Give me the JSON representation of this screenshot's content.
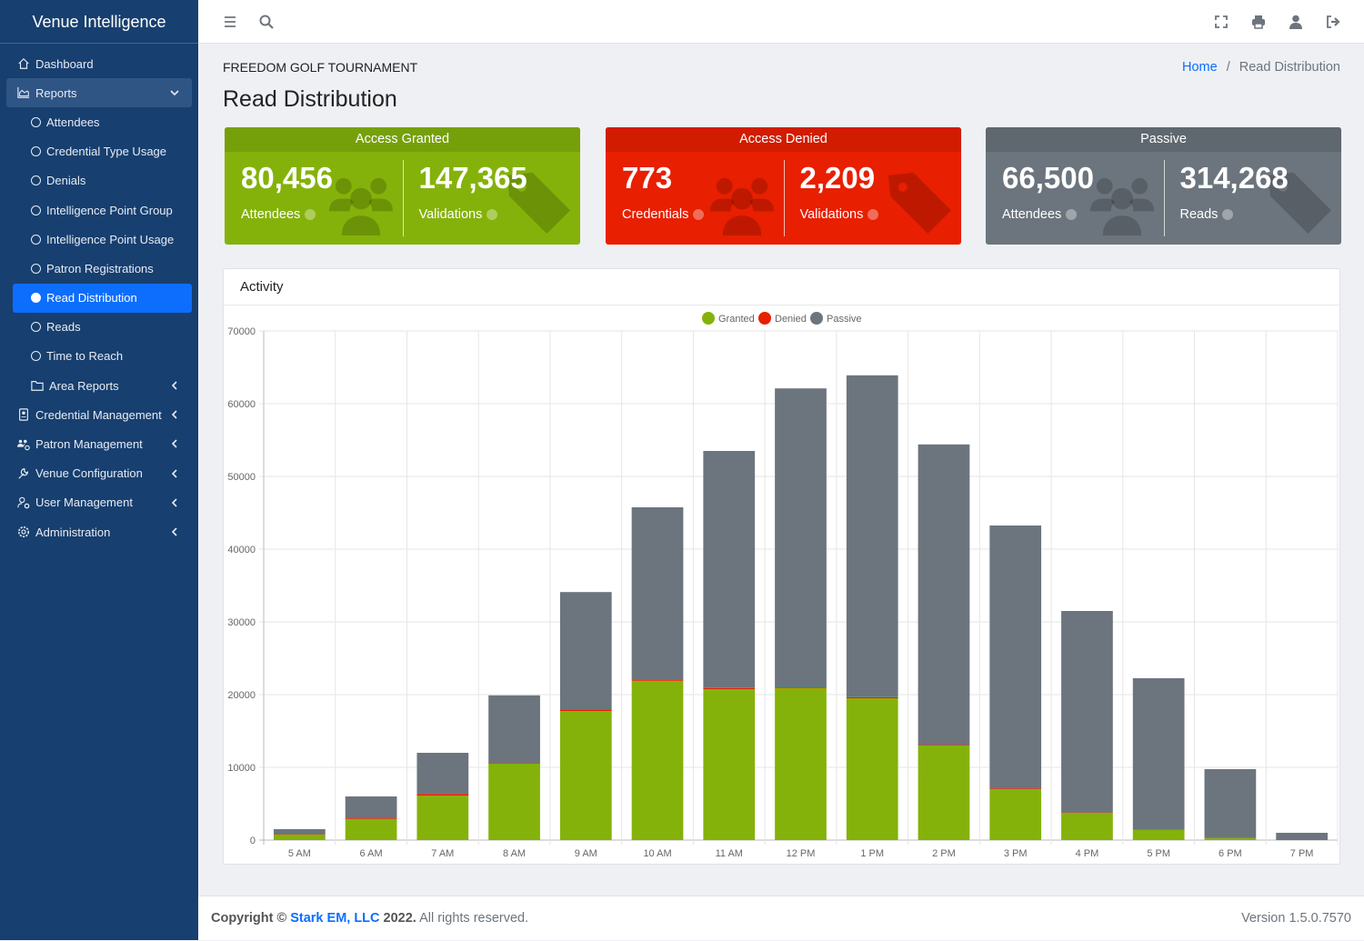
{
  "app": {
    "title": "Venue Intelligence"
  },
  "sidebar": {
    "items": [
      {
        "label": "Dashboard",
        "icon": "home-icon"
      },
      {
        "label": "Reports",
        "icon": "chart-area-icon",
        "expanded": true
      },
      {
        "label": "Attendees",
        "sub": true
      },
      {
        "label": "Credential Type Usage",
        "sub": true
      },
      {
        "label": "Denials",
        "sub": true
      },
      {
        "label": "Intelligence Point Group",
        "sub": true
      },
      {
        "label": "Intelligence Point Usage",
        "sub": true
      },
      {
        "label": "Patron Registrations",
        "sub": true
      },
      {
        "label": "Read Distribution",
        "sub": true,
        "active": true
      },
      {
        "label": "Reads",
        "sub": true
      },
      {
        "label": "Time to Reach",
        "sub": true
      },
      {
        "label": "Area Reports",
        "sub": true,
        "icon": "folder-icon",
        "chevron": true
      },
      {
        "label": "Credential Management",
        "icon": "id-badge-icon",
        "chevron": true
      },
      {
        "label": "Patron Management",
        "icon": "users-cog-icon",
        "chevron": true
      },
      {
        "label": "Venue Configuration",
        "icon": "wrench-icon",
        "chevron": true
      },
      {
        "label": "User Management",
        "icon": "user-cog-icon",
        "chevron": true
      },
      {
        "label": "Administration",
        "icon": "gear-icon",
        "chevron": true
      }
    ]
  },
  "topbar": {
    "icons": [
      "menu-icon",
      "search-icon",
      "fullscreen-icon",
      "print-icon",
      "user-icon",
      "logout-icon"
    ]
  },
  "header": {
    "event": "FREEDOM GOLF TOURNAMENT",
    "title": "Read Distribution",
    "breadcrumb": {
      "home": "Home",
      "sep": "/",
      "current": "Read Distribution"
    }
  },
  "cards": [
    {
      "title": "Access Granted",
      "color": "#84b20a",
      "header_color": "#76a00a",
      "left": {
        "value": "80,456",
        "label": "Attendees"
      },
      "right": {
        "value": "147,365",
        "label": "Validations"
      }
    },
    {
      "title": "Access Denied",
      "color": "#e81f00",
      "header_color": "#d11c00",
      "left": {
        "value": "773",
        "label": "Credentials"
      },
      "right": {
        "value": "2,209",
        "label": "Validations"
      }
    },
    {
      "title": "Passive",
      "color": "#6c757d",
      "header_color": "#5f676f",
      "left": {
        "value": "66,500",
        "label": "Attendees"
      },
      "right": {
        "value": "314,268",
        "label": "Reads"
      }
    }
  ],
  "activity": {
    "title": "Activity"
  },
  "chart_data": {
    "type": "bar",
    "stacked": true,
    "title": "",
    "xlabel": "",
    "ylabel": "",
    "categories": [
      "5 AM",
      "6 AM",
      "7 AM",
      "8 AM",
      "9 AM",
      "10 AM",
      "11 AM",
      "12 PM",
      "1 PM",
      "2 PM",
      "3 PM",
      "4 PM",
      "5 PM",
      "6 PM",
      "7 PM"
    ],
    "ylim": [
      0,
      70000
    ],
    "yticks": [
      0,
      10000,
      20000,
      30000,
      40000,
      50000,
      60000,
      70000
    ],
    "grid": true,
    "legend": "top",
    "series": [
      {
        "name": "Granted",
        "color": "#84b20a",
        "values": [
          750,
          2900,
          6100,
          10500,
          17750,
          21900,
          20750,
          20900,
          19500,
          13000,
          7000,
          3750,
          1400,
          250,
          0
        ]
      },
      {
        "name": "Denied",
        "color": "#e81f00",
        "values": [
          50,
          100,
          250,
          100,
          200,
          150,
          150,
          100,
          150,
          100,
          100,
          50,
          30,
          20,
          0
        ]
      },
      {
        "name": "Passive",
        "color": "#6c757d",
        "values": [
          700,
          3000,
          5650,
          9300,
          16150,
          23700,
          32600,
          41100,
          44250,
          41300,
          36150,
          27700,
          20820,
          9480,
          1000
        ]
      }
    ]
  },
  "footer": {
    "copyright": "Copyright ©",
    "company": "Stark EM, LLC",
    "year": "2022.",
    "rights": "All rights reserved.",
    "version": "Version 1.5.0.7570"
  }
}
